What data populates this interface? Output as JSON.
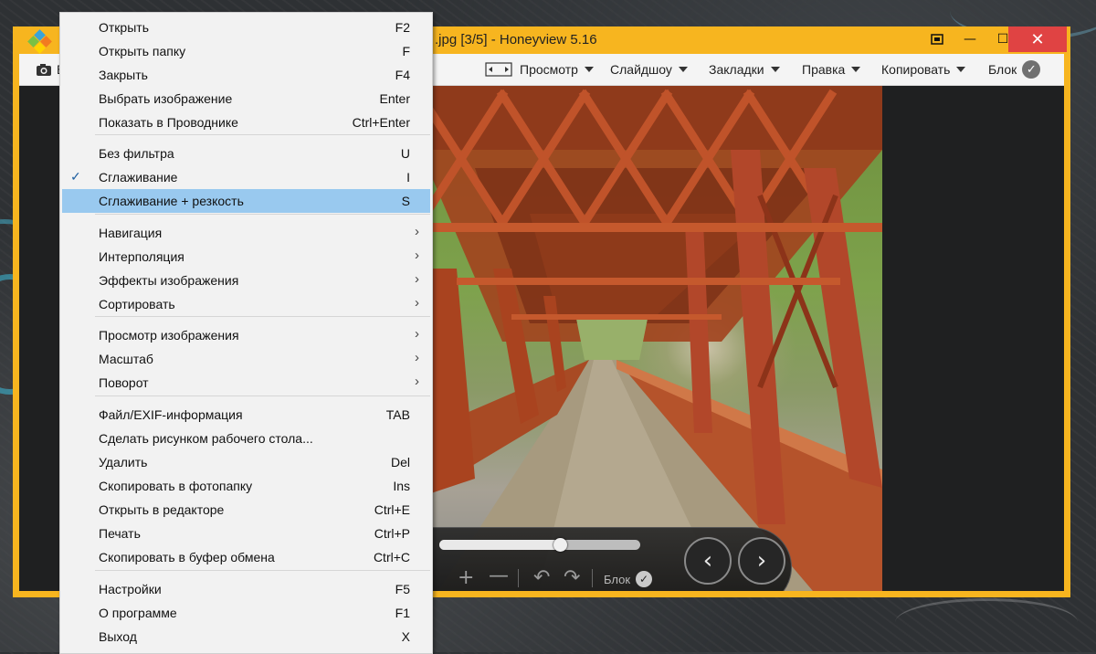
{
  "window": {
    "title": ".jpg [3/5] - Honeyview 5.16",
    "controls": {
      "fit_icon": "fullscreen-icon",
      "minimize": "—",
      "maximize": "☐",
      "close": "✕"
    }
  },
  "toolbar": {
    "left_label": "В",
    "view": "Просмотр",
    "slideshow": "Слайдшоу",
    "bookmarks": "Закладки",
    "edit": "Правка",
    "copy": "Копировать",
    "lock": "Блок"
  },
  "overlay": {
    "slider_progress": 0.6,
    "lock_label": "Блок",
    "zoom_in": "+",
    "zoom_out": "—",
    "rotate_left": "↶",
    "rotate_right": "↷",
    "prev": "‹",
    "next": "›"
  },
  "menu": {
    "items": [
      {
        "label": "Открыть",
        "shortcut": "F2"
      },
      {
        "label": "Открыть папку",
        "shortcut": "F"
      },
      {
        "label": "Закрыть",
        "shortcut": "F4"
      },
      {
        "label": "Выбрать изображение",
        "shortcut": "Enter"
      },
      {
        "label": "Показать в Проводнике",
        "shortcut": "Ctrl+Enter"
      },
      {
        "label": "Без фильтра",
        "shortcut": "U"
      },
      {
        "label": "Сглаживание",
        "shortcut": "I",
        "checked": true
      },
      {
        "label": "Сглаживание + резкость",
        "shortcut": "S",
        "highlighted": true
      },
      {
        "label": "Навигация",
        "submenu": true
      },
      {
        "label": "Интерполяция",
        "submenu": true
      },
      {
        "label": "Эффекты изображения",
        "submenu": true
      },
      {
        "label": "Сортировать",
        "submenu": true
      },
      {
        "label": "Просмотр изображения",
        "submenu": true
      },
      {
        "label": "Масштаб",
        "submenu": true
      },
      {
        "label": "Поворот",
        "submenu": true
      },
      {
        "label": "Файл/EXIF-информация",
        "shortcut": "TAB"
      },
      {
        "label": "Сделать рисунком рабочего стола...",
        "shortcut": ""
      },
      {
        "label": "Удалить",
        "shortcut": "Del"
      },
      {
        "label": "Скопировать в фотопапку",
        "shortcut": "Ins"
      },
      {
        "label": "Открыть в редакторе",
        "shortcut": "Ctrl+E"
      },
      {
        "label": "Печать",
        "shortcut": "Ctrl+P"
      },
      {
        "label": "Скопировать в буфер обмена",
        "shortcut": "Ctrl+C"
      },
      {
        "label": "Настройки",
        "shortcut": "F5"
      },
      {
        "label": "О программе",
        "shortcut": "F1"
      },
      {
        "label": "Выход",
        "shortcut": "X"
      }
    ],
    "check_glyph": "✓",
    "submenu_glyph": "›"
  },
  "colors": {
    "window_frame": "#f7b51f",
    "menu_highlight": "#99c9ef",
    "close_button": "#e04343",
    "viewer_bg": "#1f2021"
  }
}
